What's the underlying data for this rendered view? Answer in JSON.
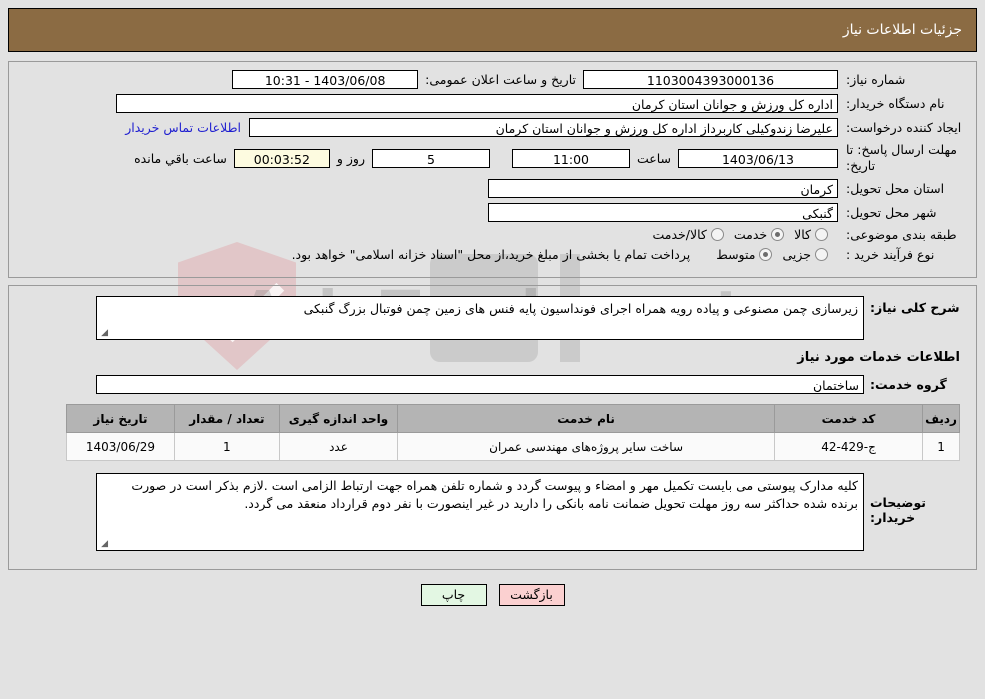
{
  "header": {
    "title": "جزئیات اطلاعات نیاز",
    "bar_color": "#8b6b43"
  },
  "top_form": {
    "need_no_label": "شماره نیاز:",
    "need_no_value": "1103004393000136",
    "announce_label": "تاریخ و ساعت اعلان عمومی:",
    "announce_value": "1403/06/08 - 10:31",
    "buyer_org_label": "نام دستگاه خریدار:",
    "buyer_org_value": "اداره کل ورزش و جوانان استان کرمان",
    "creator_label": "ایجاد کننده درخواست:",
    "creator_value": "علیرضا  زندوکیلی  کاربرداز اداره کل ورزش و جوانان استان کرمان",
    "contact_link": "اطلاعات تماس خریدار",
    "deadline_label": "مهلت ارسال پاسخ: تا تاریخ:",
    "deadline_date": "1403/06/13",
    "hour_label": "ساعت",
    "hour_value": "11:00",
    "days_value": "5",
    "days_label": "روز و",
    "countdown_value": "00:03:52",
    "countdown_label": "ساعت باقي مانده",
    "province_label": "استان محل تحویل:",
    "province_value": "کرمان",
    "city_label": "شهر محل تحویل:",
    "city_value": "گنبکی",
    "category_label": "طبقه بندی موضوعی:",
    "category_options": [
      {
        "label": "کالا",
        "selected": false
      },
      {
        "label": "خدمت",
        "selected": true
      },
      {
        "label": "کالا/خدمت",
        "selected": false
      }
    ],
    "process_label": "نوع فرآیند خرید :",
    "process_options": [
      {
        "label": "جزیی",
        "selected": false
      },
      {
        "label": "متوسط",
        "selected": true
      }
    ],
    "process_note": "پرداخت تمام یا بخشی از مبلغ خرید،از محل \"اسناد خزانه اسلامی\" خواهد بود."
  },
  "mid": {
    "desc_label": "شرح کلی نیاز:",
    "desc_value": "زیرسازی چمن مصنوعی و پیاده رویه همراه اجرای فونداسیون پایه فنس های  زمین چمن فوتبال بزرگ گنبکی",
    "section_heading": "اطلاعات خدمات مورد نیاز",
    "service_group_label": "گروه خدمت:",
    "service_group_value": "ساختمان",
    "notes_label": "توضیحات خریدار:",
    "notes_value": "کلیه مدارک پیوستی می بایست تکمیل مهر و امضاء و پیوست گردد و شماره تلفن همراه جهت ارتباط الزامی است .لازم بذکر است در صورت برنده شده حداکثر سه روز مهلت تحویل ضمانت نامه بانکی را دارید در غیر اینصورت با نفر دوم قرارداد منعقد می گردد."
  },
  "table": {
    "headers": [
      "ردیف",
      "کد خدمت",
      "نام خدمت",
      "واحد اندازه گیری",
      "تعداد / مقدار",
      "تاریخ نیاز"
    ],
    "rows": [
      {
        "radif": "1",
        "code": "ج-429-42",
        "name": "ساخت سایر پروژه‌های مهندسی عمران",
        "unit": "عدد",
        "qty": "1",
        "date": "1403/06/29"
      }
    ]
  },
  "buttons": {
    "print": "چاپ",
    "back": "بازگشت"
  },
  "watermark": {
    "text": "AriaTender.net"
  }
}
